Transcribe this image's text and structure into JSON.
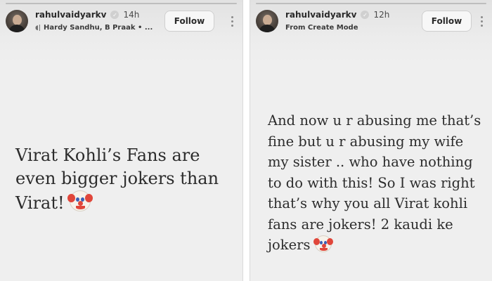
{
  "stories": [
    {
      "username": "rahulvaidyarkv",
      "verified": true,
      "time": "14h",
      "subtitle": "Hardy Sandhu, B Praak • ...",
      "subtitle_icon": "music-note-icon",
      "follow_label": "Follow",
      "text": "Virat Kohli’s Fans are even bigger jokers than Virat!",
      "trailing_emoji": "clown-face-icon"
    },
    {
      "username": "rahulvaidyarkv",
      "verified": true,
      "time": "12h",
      "subtitle": "From Create Mode",
      "follow_label": "Follow",
      "text": "And now u r abusing me that’s fine but u r abusing my wife my sister .. who have nothing to do with this! So I was right that’s why you all Virat kohli fans are jokers! 2 kaudi ke jokers",
      "trailing_emoji": "clown-face-icon"
    }
  ],
  "colors": {
    "story_background": "#efefef",
    "text": "#2c2c2c",
    "divider": "#ffffff"
  }
}
